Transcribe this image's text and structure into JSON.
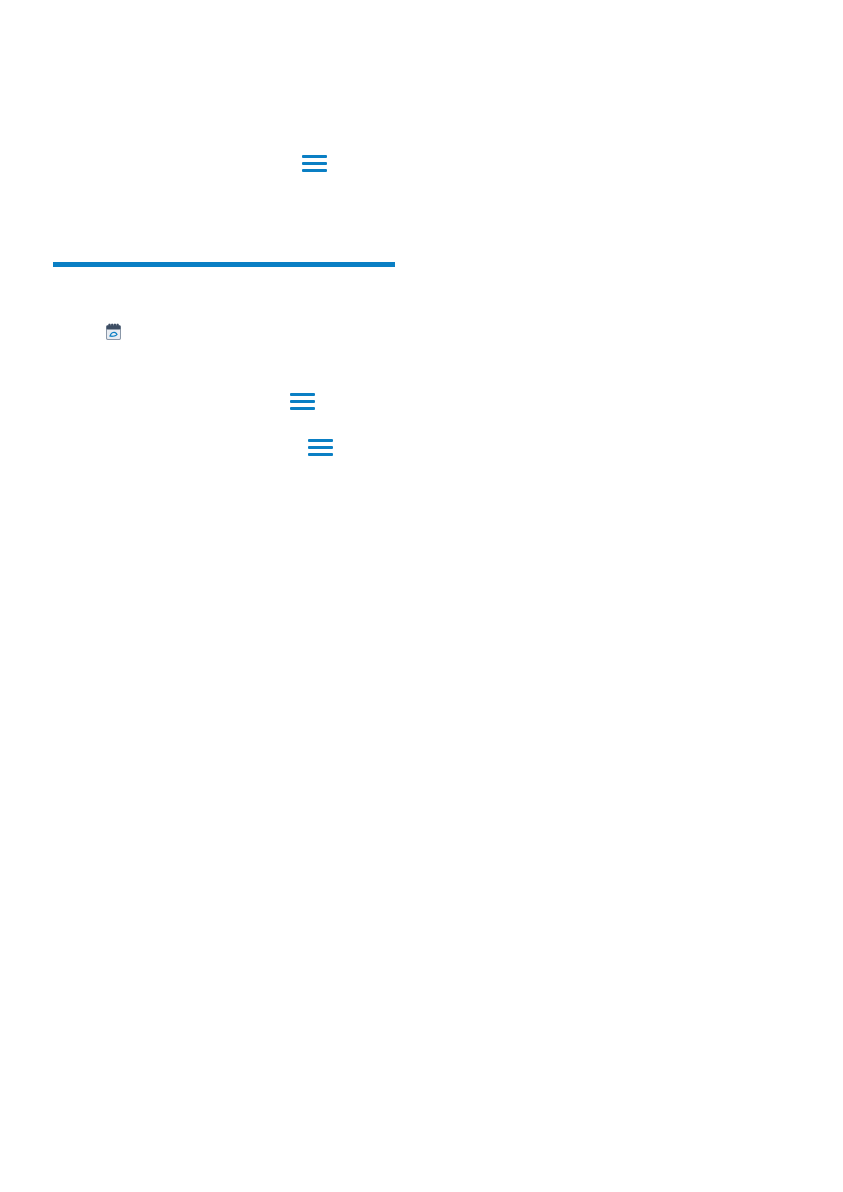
{
  "colors": {
    "accent": "#0a7fc4",
    "calendar_icon_body": "#e8ecf2",
    "calendar_icon_header": "#3d4d63",
    "calendar_icon_border": "#8a97a8"
  },
  "icons": {
    "menu_1": "menu-icon",
    "menu_2": "menu-icon",
    "menu_3": "menu-icon",
    "calendar": "calendar-icon"
  }
}
